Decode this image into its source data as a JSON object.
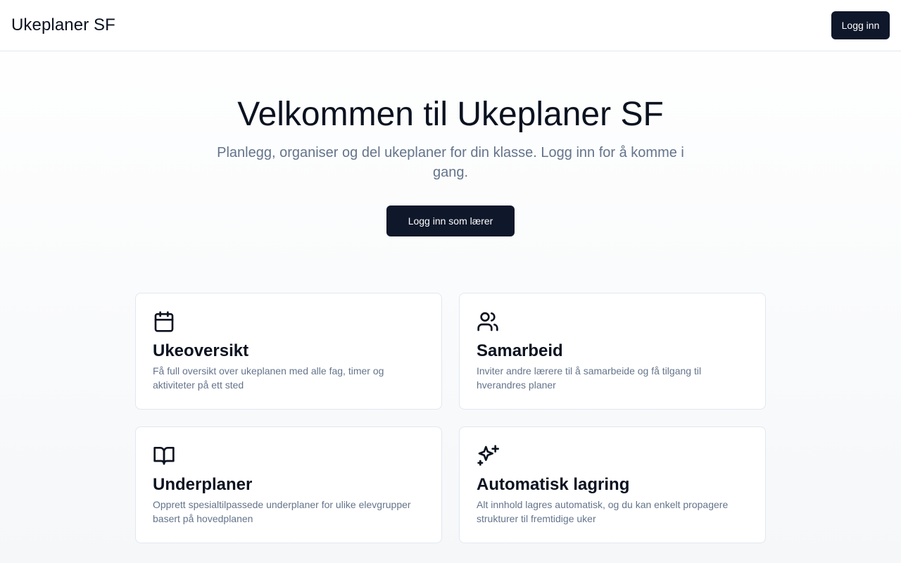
{
  "header": {
    "app_title": "Ukeplaner SF",
    "login_label": "Logg inn"
  },
  "hero": {
    "title": "Velkommen til Ukeplaner SF",
    "subtitle": "Planlegg, organiser og del ukeplaner for din klasse. Logg inn for å komme i gang.",
    "cta_label": "Logg inn som lærer"
  },
  "features": [
    {
      "icon": "calendar-icon",
      "title": "Ukeoversikt",
      "description": "Få full oversikt over ukeplanen med alle fag, timer og aktiviteter på ett sted"
    },
    {
      "icon": "users-icon",
      "title": "Samarbeid",
      "description": "Inviter andre lærere til å samarbeide og få tilgang til hverandres planer"
    },
    {
      "icon": "book-open-icon",
      "title": "Underplaner",
      "description": "Opprett spesialtilpassede underplaner for ulike elevgrupper basert på hovedplanen"
    },
    {
      "icon": "sparkles-icon",
      "title": "Automatisk lagring",
      "description": "Alt innhold lagres automatisk, og du kan enkelt propagere strukturer til fremtidige uker"
    }
  ],
  "colors": {
    "primary": "#0f172a",
    "muted_text": "#64748b",
    "border": "#e2e8f0"
  }
}
